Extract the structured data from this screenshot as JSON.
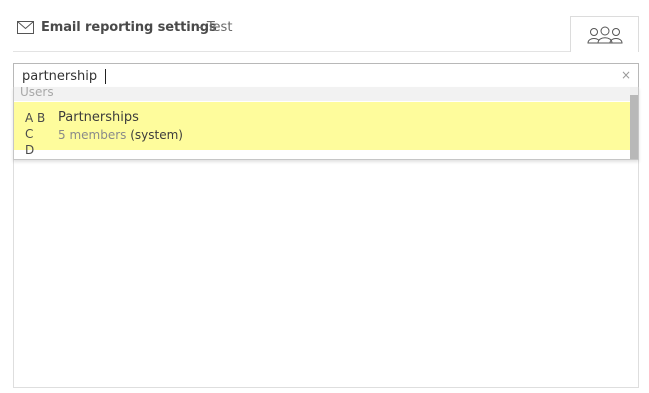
{
  "header": {
    "icon": "mail-icon",
    "title": "Email reporting settings",
    "subtitle": "- Test",
    "tab_icon": "group-icon"
  },
  "search": {
    "value": "partnership",
    "clear_icon": "close-icon",
    "clear_glyph": "×"
  },
  "dropdown": {
    "section_label": "Users",
    "results": [
      {
        "icon_text": "A B\nC\nD",
        "name": "Partnerships",
        "members": "5 members",
        "tag": "(system)",
        "highlight_color": "#fefc9c"
      }
    ]
  }
}
